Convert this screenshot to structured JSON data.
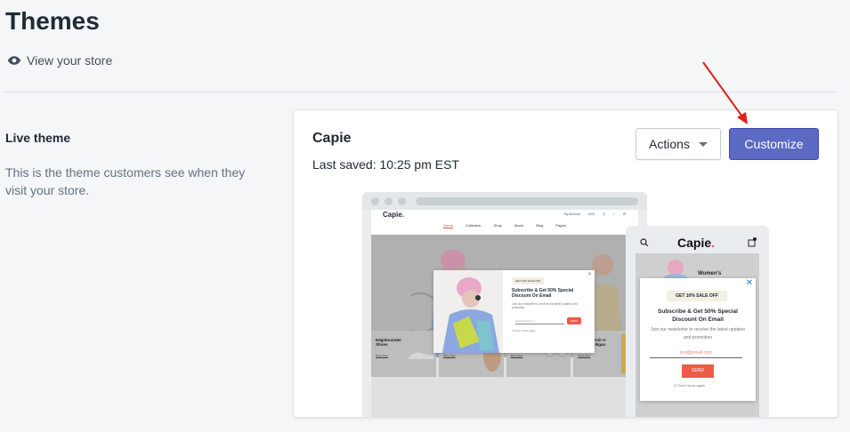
{
  "page": {
    "title": "Themes",
    "view_store": "View your store"
  },
  "live_section": {
    "heading": "Live theme",
    "description": "This is the theme customers see when they visit your store."
  },
  "theme_card": {
    "name": "Capie",
    "last_saved": "Last saved: 10:25 pm EST",
    "actions_label": "Actions",
    "customize_label": "Customize"
  },
  "preview": {
    "desktop": {
      "logo": "Capie.",
      "util": [
        "My Account",
        "USD"
      ],
      "nav": [
        "Home",
        "Collection",
        "Shop",
        "About",
        "Blog",
        "Pages"
      ],
      "products": [
        {
          "name": "Edgebounder Shoes",
          "link": "Shop Now"
        },
        {
          "name": "Contrast Buttons Coat",
          "link": "Shop Now"
        },
        {
          "name": "Aviator Sunglasses",
          "link": "Shop Now"
        },
        {
          "name": "Chunky Knit V-neck Cardigan",
          "link": "Shop Now"
        }
      ],
      "popup": {
        "badge": "GET 10% SALE OFF",
        "heading": "Subscribe & Get 50% Special Discount On Email",
        "desc": "Join our newsletter to receive the latest updates and promotion",
        "input_placeholder": "test@email.com",
        "button": "SEND",
        "checkbox": "Don't show again"
      }
    },
    "mobile": {
      "logo": "Capie",
      "logo_dot": ".",
      "hero_text": "Women's",
      "popup": {
        "badge": "GET 10% SALE OFF",
        "heading": "Subscribe & Get 50% Special Discount On Email",
        "desc": "Join our newsletter to receive the latest updates and promotion",
        "input_placeholder": "test@email.com",
        "button": "SEND",
        "checkbox": "Don't show again"
      }
    }
  },
  "colors": {
    "primary": "#5c6ac4",
    "annotation_arrow": "#e0201b"
  }
}
